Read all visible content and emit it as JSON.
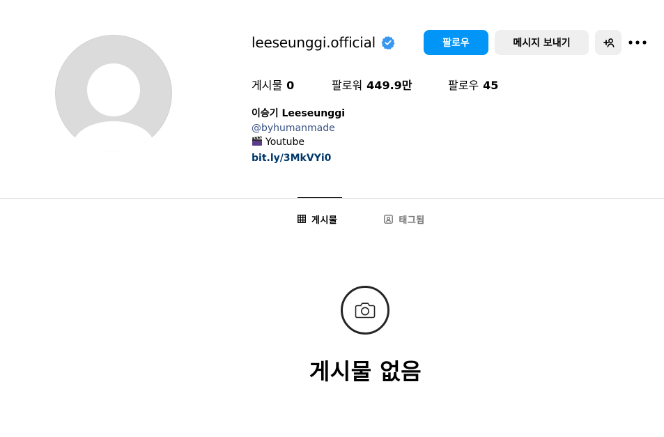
{
  "profile": {
    "username": "leeseunggi.official",
    "verified_icon": "verified-badge-icon",
    "avatar_icon": "default-avatar-icon",
    "buttons": {
      "follow": "팔로우",
      "message": "메시지 보내기",
      "add_user_icon": "add-person-icon",
      "more_icon": "more-options-icon"
    },
    "stats": {
      "posts_label": "게시물",
      "posts_value": "0",
      "followers_label": "팔로워",
      "followers_value": "449.9만",
      "following_label": "팔로우",
      "following_value": "45"
    },
    "bio": {
      "name": "이승기 Leeseunggi",
      "handle": "@byhumanmade",
      "youtube": "Youtube",
      "youtube_icon": "clapper-board-icon",
      "link": "bit.ly/3MkVYi0"
    }
  },
  "tabs": [
    {
      "label": "게시물",
      "icon": "grid-icon",
      "active": true
    },
    {
      "label": "태그됨",
      "icon": "tagged-person-icon",
      "active": false
    }
  ],
  "empty_state": {
    "icon": "camera-icon",
    "title": "게시물 없음"
  },
  "colors": {
    "accent": "#0095f6",
    "button_gray": "#efefef",
    "link": "#00376b",
    "verified": "#3897f0",
    "divider": "#dbdbdb",
    "muted": "#737373"
  }
}
